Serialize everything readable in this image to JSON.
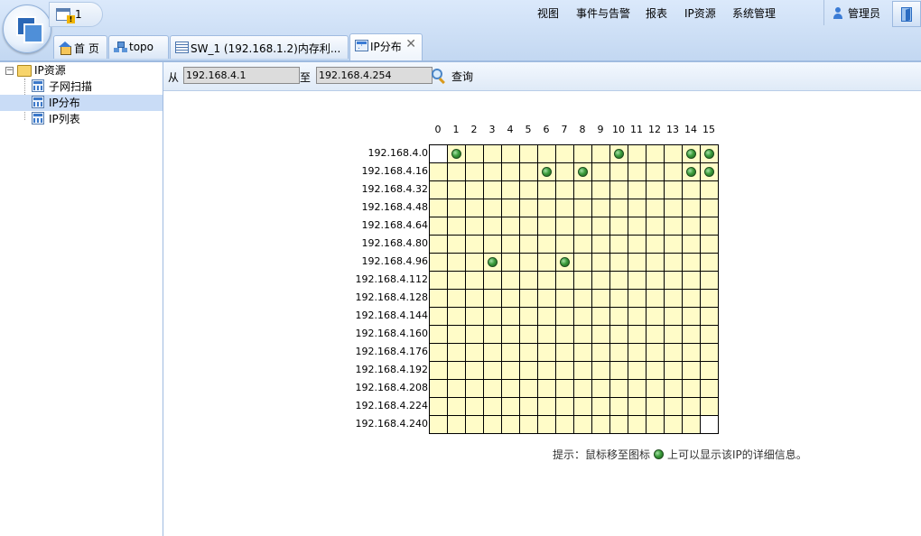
{
  "header": {
    "alert_count": "1",
    "menu": [
      "视图",
      "事件与告警",
      "报表",
      "IP资源",
      "系统管理"
    ],
    "user": "管理员"
  },
  "tabs": [
    {
      "label": "首 页",
      "icon": "home-icon"
    },
    {
      "label": "topo",
      "icon": "topology-icon"
    },
    {
      "label": "SW_1 (192.168.1.2)内存利...",
      "icon": "list-icon"
    },
    {
      "label": "IP分布",
      "icon": "ip-distribution-icon",
      "active": true,
      "close": "✕"
    }
  ],
  "sidebar": {
    "root": "IP资源",
    "items": [
      {
        "label": "子网扫描",
        "icon": "subnet-scan-icon"
      },
      {
        "label": "IP分布",
        "icon": "ip-distribution-icon",
        "selected": true
      },
      {
        "label": "IP列表",
        "icon": "ip-list-icon"
      }
    ]
  },
  "query": {
    "from_label": "从",
    "from_value": "192.168.4.1",
    "to_label": "至",
    "to_value": "192.168.4.254",
    "search_label": "查询"
  },
  "grid": {
    "columns": [
      "0",
      "1",
      "2",
      "3",
      "4",
      "5",
      "6",
      "7",
      "8",
      "9",
      "10",
      "11",
      "12",
      "13",
      "14",
      "15"
    ],
    "rows": [
      "192.168.4.0",
      "192.168.4.16",
      "192.168.4.32",
      "192.168.4.48",
      "192.168.4.64",
      "192.168.4.80",
      "192.168.4.96",
      "192.168.4.112",
      "192.168.4.128",
      "192.168.4.144",
      "192.168.4.160",
      "192.168.4.176",
      "192.168.4.192",
      "192.168.4.208",
      "192.168.4.224",
      "192.168.4.240"
    ],
    "out_of_range_cells": [
      [
        0,
        0
      ],
      [
        15,
        15
      ]
    ],
    "used_ips": [
      [
        0,
        1
      ],
      [
        0,
        10
      ],
      [
        0,
        14
      ],
      [
        0,
        15
      ],
      [
        1,
        6
      ],
      [
        1,
        8
      ],
      [
        1,
        14
      ],
      [
        1,
        15
      ],
      [
        6,
        3
      ],
      [
        6,
        7
      ]
    ],
    "colors": {
      "free": "#fffcc8",
      "out_of_range": "#ffffff",
      "used": "#3c9d3c"
    }
  },
  "hint": {
    "before": "提示：鼠标移至图标",
    "after": "上可以显示该IP的详细信息。"
  }
}
